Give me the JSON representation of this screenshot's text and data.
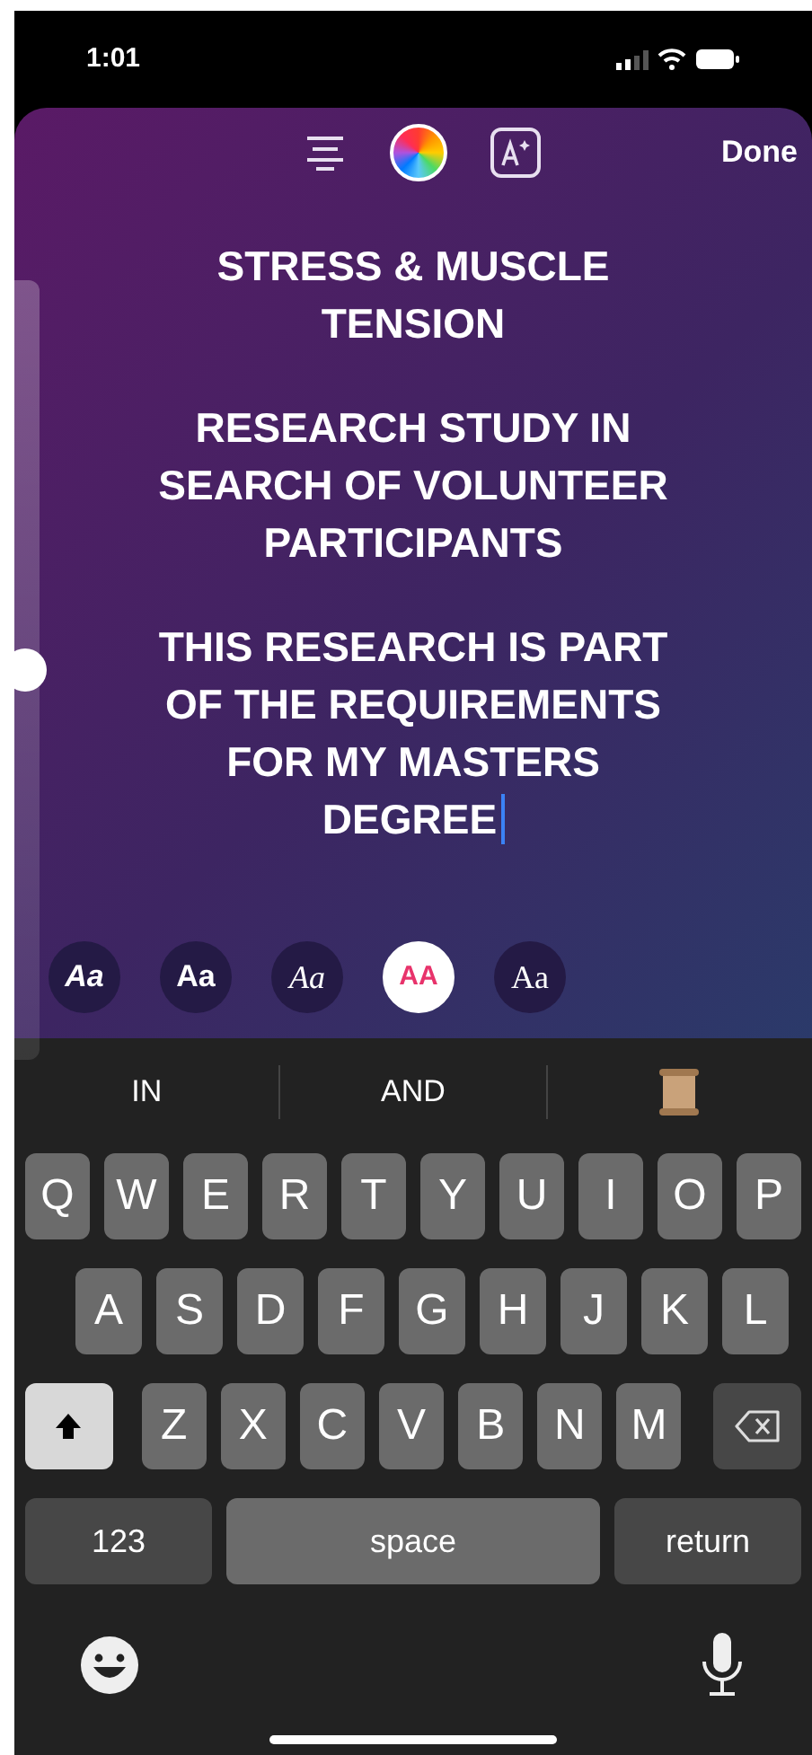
{
  "status_bar": {
    "time": "1:01"
  },
  "toolbar": {
    "done": "Done"
  },
  "size_slider": {
    "level": 0.5
  },
  "paragraphs": [
    {
      "lines": [
        "STRESS & MUSCLE",
        "TENSION"
      ]
    },
    {
      "lines": [
        "RESEARCH STUDY IN",
        "SEARCH OF VOLUNTEER",
        "PARTICIPANTS"
      ]
    },
    {
      "lines": [
        "THIS RESEARCH IS PART",
        "OF THE REQUIREMENTS",
        "FOR MY MASTERS",
        "DEGREE"
      ]
    }
  ],
  "font_styles": [
    {
      "label": "Aa",
      "kind": "bold-italic",
      "selected": false
    },
    {
      "label": "Aa",
      "kind": "rounded",
      "selected": false
    },
    {
      "label": "Aa",
      "kind": "serif-italic",
      "selected": false
    },
    {
      "label": "AA",
      "kind": "caps",
      "selected": true
    },
    {
      "label": "Aa",
      "kind": "serif",
      "selected": false
    }
  ],
  "suggestions": [
    "IN",
    "AND"
  ],
  "keyboard": {
    "rows": [
      [
        {
          "kind": "letter",
          "label": "Q"
        },
        {
          "kind": "letter",
          "label": "W"
        },
        {
          "kind": "letter",
          "label": "E"
        },
        {
          "kind": "letter",
          "label": "R"
        },
        {
          "kind": "letter",
          "label": "T"
        },
        {
          "kind": "letter",
          "label": "Y"
        },
        {
          "kind": "letter",
          "label": "U"
        },
        {
          "kind": "letter",
          "label": "I"
        },
        {
          "kind": "letter",
          "label": "O"
        },
        {
          "kind": "letter",
          "label": "P"
        }
      ],
      [
        {
          "kind": "letter",
          "label": "A"
        },
        {
          "kind": "letter",
          "label": "S"
        },
        {
          "kind": "letter",
          "label": "D"
        },
        {
          "kind": "letter",
          "label": "F"
        },
        {
          "kind": "letter",
          "label": "G"
        },
        {
          "kind": "letter",
          "label": "H"
        },
        {
          "kind": "letter",
          "label": "J"
        },
        {
          "kind": "letter",
          "label": "K"
        },
        {
          "kind": "letter",
          "label": "L"
        }
      ],
      [
        {
          "kind": "shift",
          "on": true
        },
        {
          "kind": "letter",
          "label": "Z"
        },
        {
          "kind": "letter",
          "label": "X"
        },
        {
          "kind": "letter",
          "label": "C"
        },
        {
          "kind": "letter",
          "label": "V"
        },
        {
          "kind": "letter",
          "label": "B"
        },
        {
          "kind": "letter",
          "label": "N"
        },
        {
          "kind": "letter",
          "label": "M"
        },
        {
          "kind": "delete"
        }
      ]
    ],
    "bottom_keys": {
      "numbers": "123",
      "space": "space",
      "return": "return"
    }
  }
}
